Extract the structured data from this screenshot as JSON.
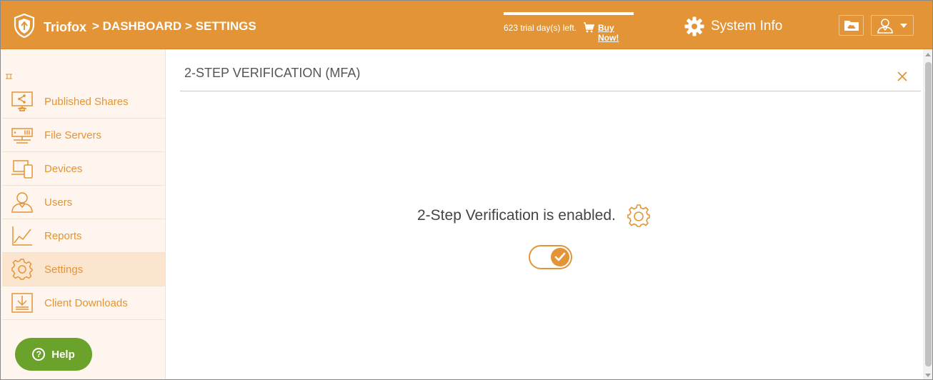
{
  "header": {
    "brand": "Triofox",
    "breadcrumb": [
      "> DASHBOARD",
      "> SETTINGS"
    ],
    "trial_text": "623 trial day(s) left.",
    "buy_link": "Buy Now!",
    "system_info": "System Info",
    "icons": [
      "triofox-logo-icon",
      "cart-icon",
      "gear-icon",
      "cloud-folder-icon",
      "user-icon",
      "caret-down-icon"
    ]
  },
  "sidebar": {
    "items": [
      {
        "label": "Published Shares",
        "icon": "share-monitor-icon"
      },
      {
        "label": "File Servers",
        "icon": "server-icon"
      },
      {
        "label": "Devices",
        "icon": "devices-icon"
      },
      {
        "label": "Users",
        "icon": "user-icon"
      },
      {
        "label": "Reports",
        "icon": "chart-line-icon"
      },
      {
        "label": "Settings",
        "icon": "gear-icon",
        "active": true
      },
      {
        "label": "Client Downloads",
        "icon": "download-icon"
      }
    ],
    "help_label": "Help"
  },
  "main": {
    "title": "2-STEP VERIFICATION (MFA)",
    "status": "2-Step Verification is enabled.",
    "toggle_on": true
  },
  "colors": {
    "accent": "#e39437",
    "help_green": "#6aa22c",
    "sidebar_bg": "#fdf5ee",
    "active_bg": "#fce5cf"
  }
}
